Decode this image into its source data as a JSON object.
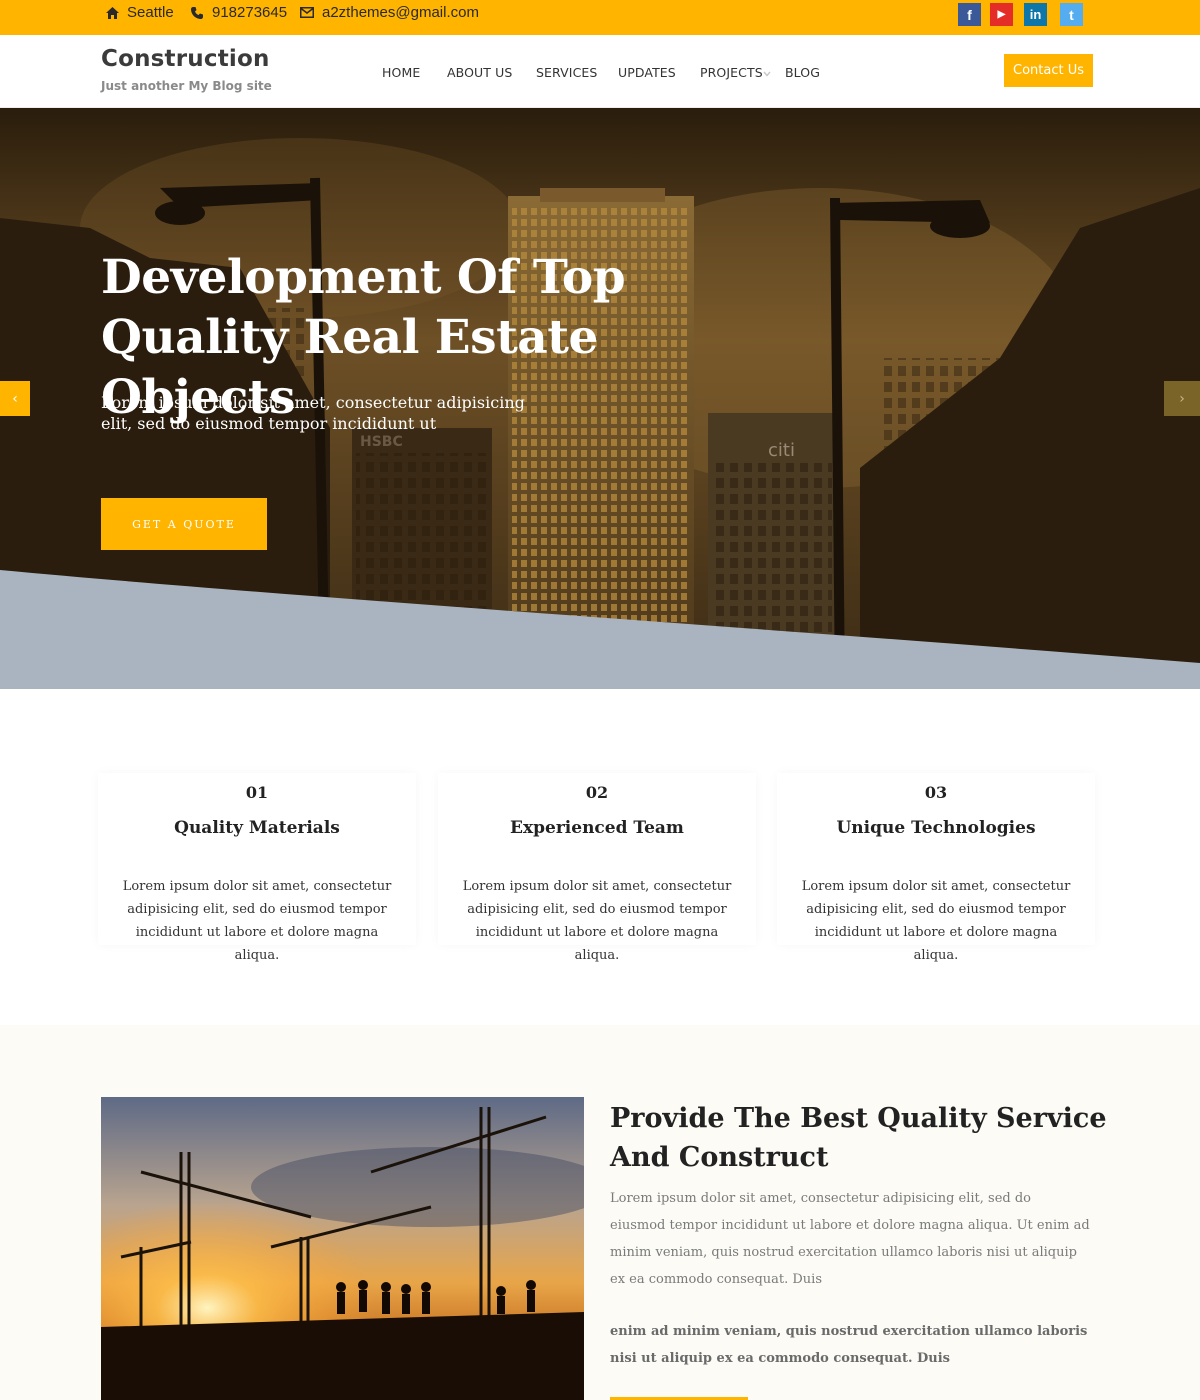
{
  "topbar": {
    "location": "Seattle",
    "phone": "918273645",
    "email": "a2zthemes@gmail.com",
    "location_icon": "home-icon",
    "phone_icon": "phone-icon",
    "email_icon": "envelope-icon",
    "social": [
      {
        "icon": "facebook-icon",
        "glyph": "f",
        "color": "#3b5998"
      },
      {
        "icon": "youtube-icon",
        "glyph": "▶",
        "color": "#e52d27"
      },
      {
        "icon": "linkedin-icon",
        "glyph": "in",
        "color": "#0e76a8"
      },
      {
        "icon": "twitter-icon",
        "glyph": "t",
        "color": "#55acee"
      }
    ]
  },
  "header": {
    "site_title": "Construction",
    "tagline": "Just another My Blog site",
    "nav": [
      {
        "label": "HOME"
      },
      {
        "label": "ABOUT US"
      },
      {
        "label": "SERVICES"
      },
      {
        "label": "UPDATES"
      },
      {
        "label": "PROJECTS"
      },
      {
        "label": "BLOG"
      }
    ],
    "contact_label": "Contact Us"
  },
  "hero": {
    "title": "Development Of Top Quality Real Estate Objects",
    "subtitle": "Lorem ipsum dolor sit amet, consectetur adipisicing elit, sed do eiusmod tempor incididunt ut",
    "cta_label": "GET A QUOTE",
    "prev_arrow": "‹",
    "next_arrow": "›",
    "sign_left": "HSBC",
    "sign_right": "citi"
  },
  "features": [
    {
      "number": "01",
      "title": "Quality Materials",
      "text": "Lorem ipsum dolor sit amet, consectetur adipisicing elit, sed do eiusmod tempor incididunt ut labore et dolore magna aliqua."
    },
    {
      "number": "02",
      "title": "Experienced Team",
      "text": "Lorem ipsum dolor sit amet, consectetur adipisicing elit, sed do eiusmod tempor incididunt ut labore et dolore magna aliqua."
    },
    {
      "number": "03",
      "title": "Unique Technologies",
      "text": "Lorem ipsum dolor sit amet, consectetur adipisicing elit, sed do eiusmod tempor incididunt ut labore et dolore magna aliqua."
    }
  ],
  "about": {
    "title": "Provide The Best Quality Service And Construct",
    "paragraph1": "Lorem ipsum dolor sit amet, consectetur adipisicing elit, sed do eiusmod tempor incididunt ut labore et dolore magna aliqua. Ut enim ad minim veniam, quis nostrud exercitation ullamco laboris nisi ut aliquip ex ea commodo consequat. Duis",
    "paragraph2": "enim ad minim veniam, quis nostrud exercitation ullamco laboris nisi ut aliquip ex ea commodo consequat. Duis"
  },
  "colors": {
    "accent": "#ffb400",
    "hero_band": "#aab4c0",
    "about_bg": "#fcfbf6"
  }
}
